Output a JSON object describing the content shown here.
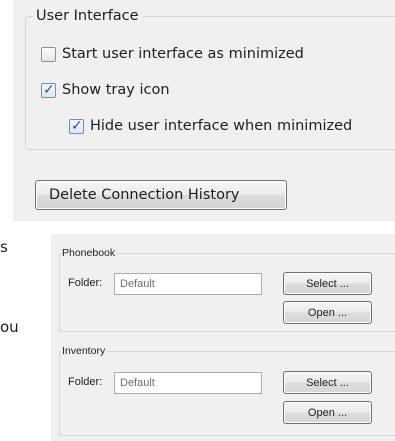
{
  "user_interface": {
    "group_title": "User Interface",
    "start_minimized": {
      "label": "Start user interface as minimized",
      "checked": false
    },
    "show_tray_icon": {
      "label": "Show tray icon",
      "checked": true
    },
    "hide_when_minimized": {
      "label": "Hide user interface when minimized",
      "checked": true
    },
    "delete_history_label": "Delete Connection History"
  },
  "edge_text": [
    "s",
    "ou"
  ],
  "phonebook": {
    "group_title": "Phonebook",
    "folder_label": "Folder:",
    "folder_value": "Default",
    "select_label": "Select ...",
    "open_label": "Open ..."
  },
  "inventory": {
    "group_title": "Inventory",
    "folder_label": "Folder:",
    "folder_value": "Default",
    "select_label": "Select ...",
    "open_label": "Open ..."
  }
}
